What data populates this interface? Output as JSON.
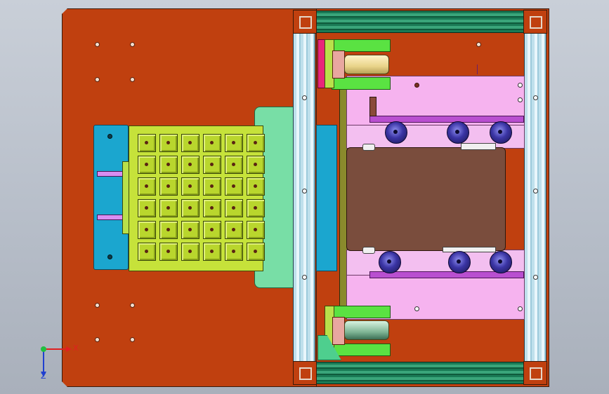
{
  "axis": {
    "x_label": "X",
    "y_label": "Z"
  },
  "colors": {
    "plate": "#c0400f",
    "grid": "#c6e23a",
    "rail_vertical": "#bfe0ec",
    "rail_horizontal": "#1a7a55",
    "cyan": "#1ba6cf",
    "mint": "#78dea6",
    "pink": "#f6b3ef",
    "purple": "#b94fd0",
    "brown": "#7a4d3d",
    "wheel": "#3a34a4"
  },
  "grid": {
    "rows": 6,
    "cols": 6
  }
}
